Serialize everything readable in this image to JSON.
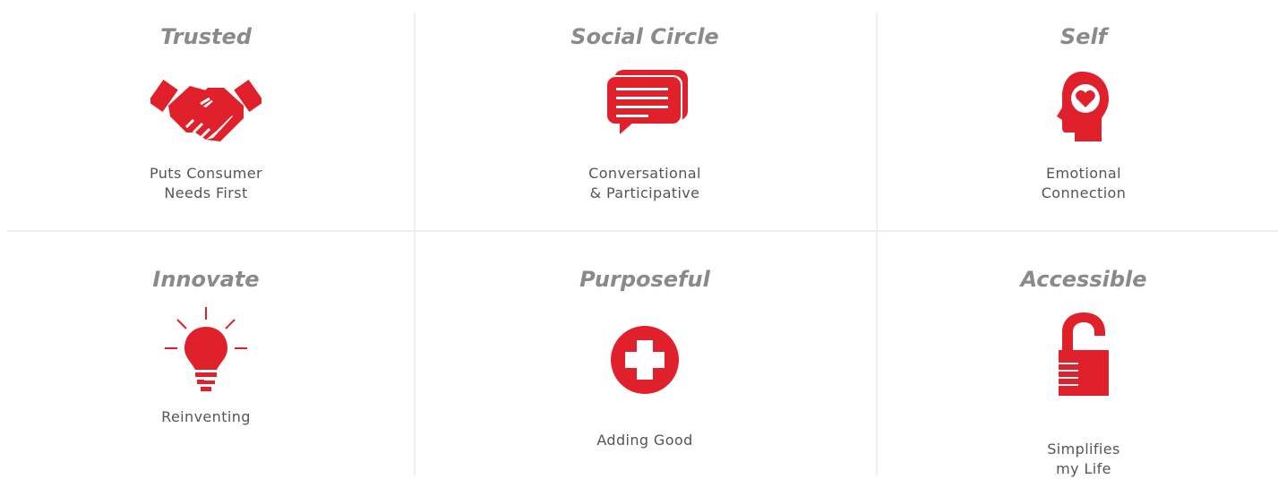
{
  "accent_color": "#e0202a",
  "cards": [
    {
      "title": "Trusted",
      "icon": "handshake-icon",
      "caption_lines": [
        "Puts Consumer",
        "Needs First"
      ]
    },
    {
      "title": "Social Circle",
      "icon": "chat-bubbles-icon",
      "caption_lines": [
        "Conversational",
        "& Participative"
      ]
    },
    {
      "title": "Self",
      "icon": "head-heart-icon",
      "caption_lines": [
        "Emotional",
        "Connection"
      ]
    },
    {
      "title": "Innovate",
      "icon": "lightbulb-icon",
      "caption_lines": [
        "Reinventing"
      ]
    },
    {
      "title": "Purposeful",
      "icon": "plus-circle-icon",
      "caption_lines": [
        "Adding Good"
      ]
    },
    {
      "title": "Accessible",
      "icon": "open-padlock-icon",
      "caption_lines": [
        "Simplifies",
        "my Life"
      ]
    }
  ]
}
